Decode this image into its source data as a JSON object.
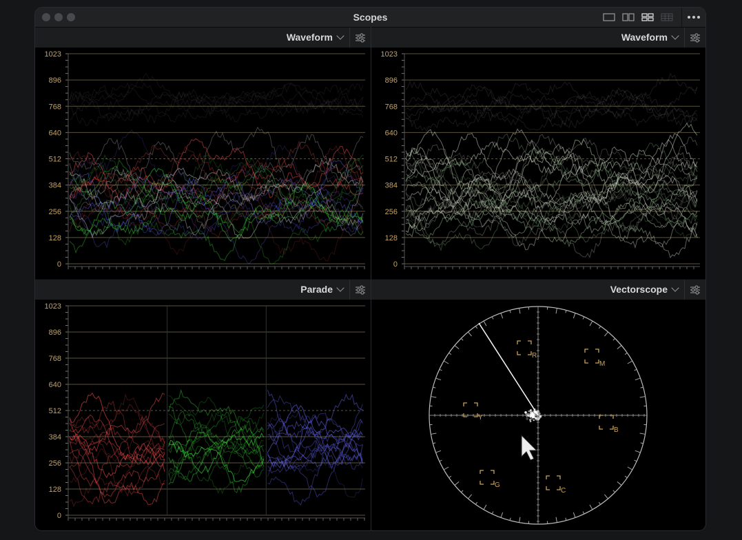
{
  "window": {
    "title": "Scopes"
  },
  "toolbar": {
    "layout_icons": [
      "single-layout-icon",
      "dual-layout-icon",
      "quad-layout-icon",
      "grid-layout-icon"
    ],
    "active_layout": "quad-layout-icon",
    "more_icon": "more-dots-icon"
  },
  "panels": [
    {
      "scope": "Waveform",
      "settings_icon": "sliders-icon",
      "scale_labels": [
        "1023",
        "896",
        "768",
        "640",
        "512",
        "384",
        "256",
        "128",
        "0"
      ],
      "mode": "rgb-overlay"
    },
    {
      "scope": "Waveform",
      "settings_icon": "sliders-icon",
      "scale_labels": [
        "1023",
        "896",
        "768",
        "640",
        "512",
        "384",
        "256",
        "128",
        "0"
      ],
      "mode": "luma"
    },
    {
      "scope": "Parade",
      "settings_icon": "sliders-icon",
      "scale_labels": [
        "1023",
        "896",
        "768",
        "640",
        "512",
        "384",
        "256",
        "128",
        "0"
      ],
      "mode": "rgb-parade"
    },
    {
      "scope": "Vectorscope",
      "settings_icon": "sliders-icon",
      "targets": [
        "R",
        "M",
        "Y",
        "B",
        "G",
        "C"
      ],
      "mode": "vectorscope"
    }
  ],
  "colors": {
    "scale_label": "#c9a25a",
    "graticule": "#c9b98a",
    "target_box": "#c9a25a",
    "trace_red": "#ff5050",
    "trace_green": "#42ff42",
    "trace_blue": "#6a6aff"
  }
}
